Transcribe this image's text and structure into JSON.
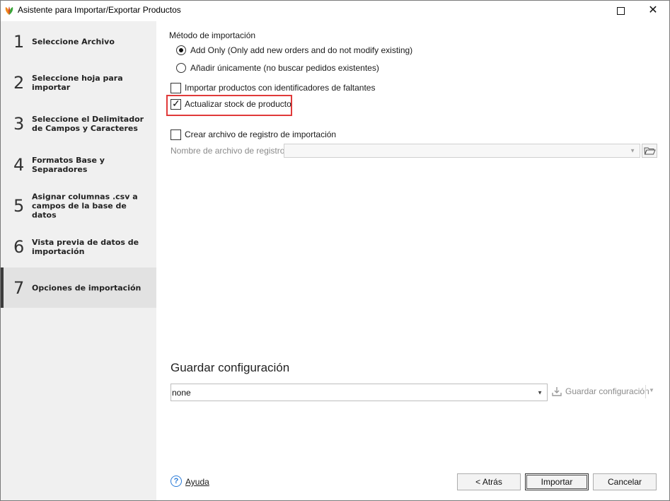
{
  "window": {
    "title": "Asistente para Importar/Exportar Productos"
  },
  "steps": [
    {
      "num": "1",
      "label": "Seleccione Archivo",
      "active": false
    },
    {
      "num": "2",
      "label": "Seleccione hoja para importar",
      "active": false
    },
    {
      "num": "3",
      "label": "Seleccione el Delimitador de Campos y Caracteres",
      "active": false
    },
    {
      "num": "4",
      "label": "Formatos Base y Separadores",
      "active": false
    },
    {
      "num": "5",
      "label": "Asignar columnas .csv a campos de la base de datos",
      "active": false
    },
    {
      "num": "6",
      "label": "Vista previa de datos de importación",
      "active": false
    },
    {
      "num": "7",
      "label": "Opciones de importación",
      "active": true
    }
  ],
  "options": {
    "import_method_label": "Método de importación",
    "radio_add_only": "Add Only (Only add new orders and do not modify existing)",
    "radio_add_unique": "Añadir únicamente (no buscar pedidos existentes)",
    "check_missing_ids": "Importar productos con identificadores de faltantes",
    "check_update_stock": "Actualizar stock de producto",
    "check_create_log": "Crear archivo de registro de importación",
    "log_file_label": "Nombre de archivo de registro",
    "log_file_value": ""
  },
  "config": {
    "title": "Guardar configuración",
    "selected": "none",
    "save_label": "Guardar configuración"
  },
  "footer": {
    "help": "Ayuda",
    "back": "< Atrás",
    "import": "Importar",
    "cancel": "Cancelar"
  }
}
